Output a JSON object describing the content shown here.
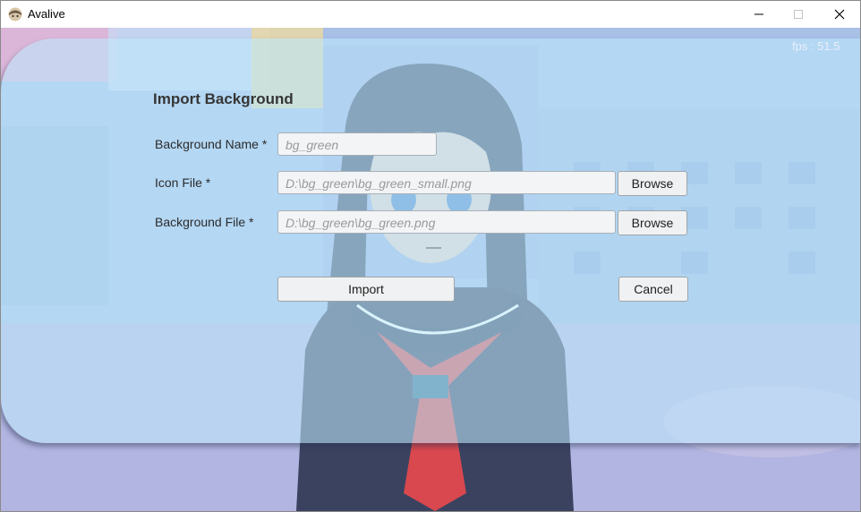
{
  "window": {
    "title": "Avalive"
  },
  "overlay": {
    "fps_text": "fps : 51.5"
  },
  "form": {
    "title": "Import Background",
    "background_name": {
      "label": "Background Name *",
      "placeholder": "bg_green"
    },
    "icon_file": {
      "label": "Icon File *",
      "placeholder": "D:\\bg_green\\bg_green_small.png",
      "browse_label": "Browse"
    },
    "background_file": {
      "label": "Background File *",
      "placeholder": "D:\\bg_green\\bg_green.png",
      "browse_label": "Browse"
    },
    "import_label": "Import",
    "cancel_label": "Cancel"
  }
}
